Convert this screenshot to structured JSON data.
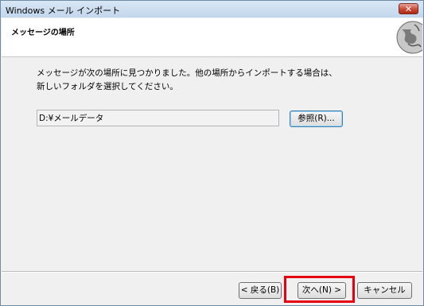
{
  "window": {
    "title": "Windows メール インポート",
    "close_label": "✕"
  },
  "header": {
    "title": "メッセージの場所",
    "icon": "globe-icon"
  },
  "main": {
    "description": "メッセージが次の場所に見つかりました。他の場所からインポートする場合は、新しいフォルダを選択してください。",
    "path_value": "D:¥メールデータ",
    "browse_label": "参照(R)..."
  },
  "footer": {
    "back_label": "< 戻る(B)",
    "next_label": "次へ(N) >",
    "cancel_label": "キャンセル"
  },
  "colors": {
    "highlight": "#e60012",
    "close_button": "#c94a36"
  }
}
